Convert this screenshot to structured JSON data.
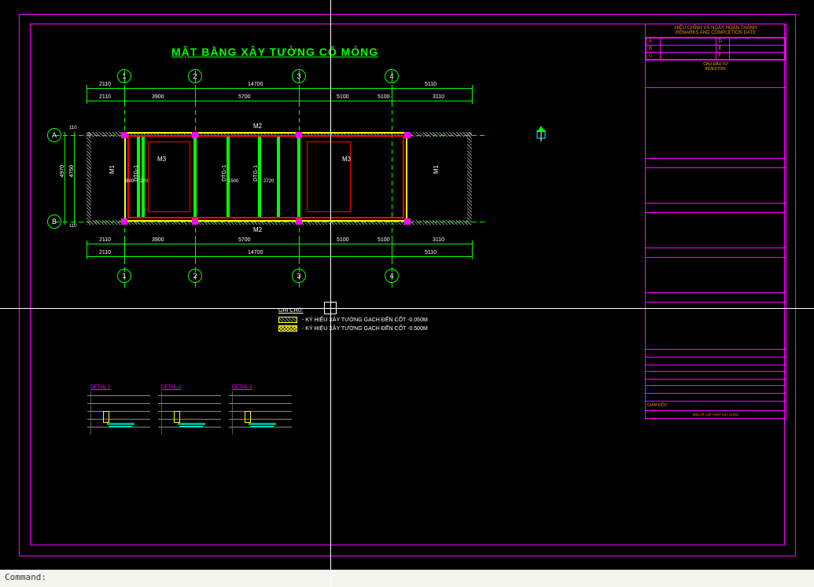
{
  "drawing": {
    "title": "MẶT BẰNG XÂY TƯỜNG CỔ MÓNG"
  },
  "grids": {
    "cols": [
      "1",
      "2",
      "3",
      "4"
    ],
    "rows": [
      "A",
      "B"
    ]
  },
  "dims": {
    "top_outer": [
      "2110",
      "14700",
      "5110"
    ],
    "top_inner": [
      "2110",
      "3900",
      "5700",
      "5100",
      "5100",
      "3110"
    ],
    "bottom_inner": [
      "2110",
      "3900",
      "5700",
      "5100",
      "5100",
      "3110"
    ],
    "bottom_outer": [
      "2110",
      "14700",
      "5110"
    ],
    "left_outer": "4970",
    "left_inner": [
      "110",
      "4750",
      "110"
    ],
    "int": [
      "880",
      "220",
      "1500",
      "2720"
    ]
  },
  "labels": {
    "m1_left": "M1",
    "m1_right": "M1",
    "m2_top": "M2",
    "m2_bottom": "M2",
    "m3_1": "M3",
    "m3_2": "M3",
    "dtg1_1": "DTG-1",
    "dtg1_2": "DTG-1",
    "dtg1_3": "DTG-1"
  },
  "legend": {
    "title": "GHI CHÚ:",
    "item1": "- KÝ HIỆU XÂY TƯỜNG GẠCH ĐẾN CỐT -0.050M",
    "item2": "- KÝ HIỆU XÂY TƯỜNG GẠCH ĐẾN CỐT -0.500M"
  },
  "details": {
    "d1": "DETAIL 1",
    "d2": "DETAIL 2",
    "d3": "DETAIL 3"
  },
  "titleblock": {
    "hdr1": "HIỆU CHỈNH VÀ NGÀY HOÀN THÀNH",
    "hdr2": "REMARKS AND COMPLETION DATE",
    "a": "A",
    "b": "B",
    "c": "C",
    "d": "D",
    "e": "E",
    "f": "F",
    "investor1": "CHỦ ĐẦU TƯ",
    "investor2": "INVESTOR:",
    "gd": "GIÁM ĐỐC:",
    "foot": "BẢN VẼ CẤP PHÉP XÂY DỰNG"
  },
  "cmd": {
    "prompt": "Command:"
  }
}
